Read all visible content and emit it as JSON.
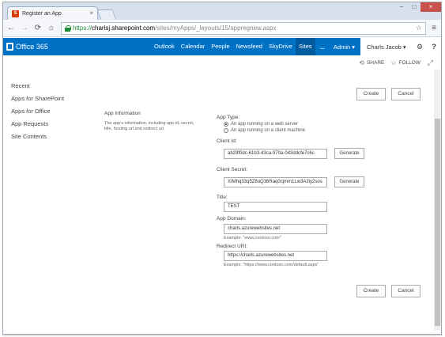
{
  "browser": {
    "tab_title": "Register an App",
    "tab_favicon": "S",
    "url_https": "https://",
    "url_host": "charlsj.sharepoint.com",
    "url_path": "/sites/myApps/_layouts/15/appregnew.aspx"
  },
  "suite": {
    "brand": "Office 365",
    "links": [
      "Outlook",
      "Calendar",
      "People",
      "Newsfeed",
      "SkyDrive",
      "Sites"
    ],
    "active_link": "Sites",
    "more": "...",
    "admin": "Admin ▾",
    "user": "Charls Jacob ▾",
    "help": "?"
  },
  "ribbon": {
    "share": "SHARE",
    "follow": "FOLLOW"
  },
  "leftnav": {
    "items": [
      "Recent",
      "Apps for SharePoint",
      "Apps for Office",
      "App Requests",
      "Site Contents"
    ]
  },
  "section": {
    "title": "App Information",
    "description": "The app's information, including app id, secret, title, hosting url and redirect url."
  },
  "form": {
    "app_type_label": "App Type:",
    "app_type_options": [
      "An app running on a web server",
      "An app running on a client machine"
    ],
    "app_type_selected": 0,
    "client_id_label": "Client Id:",
    "client_id_value": "ab29f0dc-61b3-43ca-970a-043ddcfe7c6c",
    "client_secret_label": "Client Secret:",
    "client_secret_value": "XIMhq33q5Z8uQ36Raq0cjmm1Lw3AJty2sos",
    "generate_label": "Generate",
    "title_label": "Title:",
    "title_value": "TEST",
    "domain_label": "App Domain:",
    "domain_value": "charls.azurewebsites.net",
    "domain_example": "Example: \"www.contoso.com\"",
    "redirect_label": "Redirect URI:",
    "redirect_value": "https://charls.azurewebsites.net",
    "redirect_example": "Example: \"https://www.contoso.com/default.aspx\""
  },
  "actions": {
    "create": "Create",
    "cancel": "Cancel"
  },
  "colors": {
    "suite_bar": "#0072c6",
    "suite_active": "#005a9e",
    "secure_green": "#1e8a3a"
  }
}
